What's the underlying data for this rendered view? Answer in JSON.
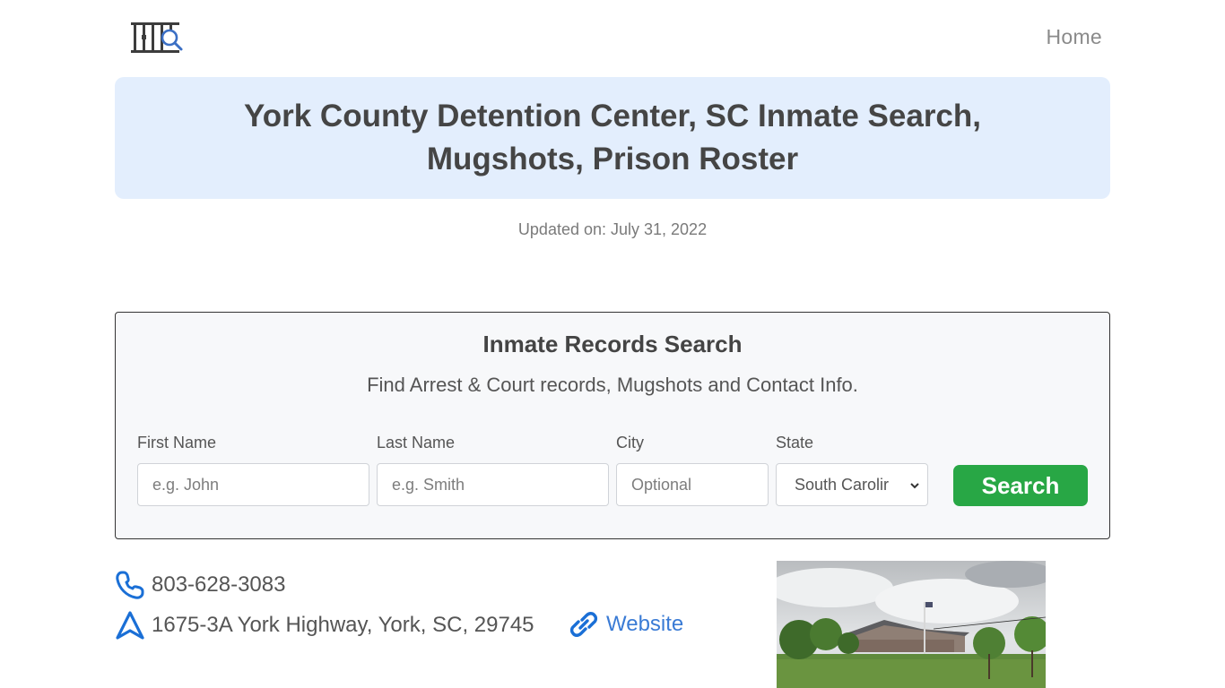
{
  "header": {
    "logo_icon": "jail-bars-magnifier-icon",
    "nav": [
      {
        "label": "Home"
      }
    ]
  },
  "title": "York County Detention Center, SC Inmate Search, Mugshots, Prison Roster",
  "updated": "Updated on: July 31, 2022",
  "search": {
    "title": "Inmate Records Search",
    "subtitle": "Find Arrest & Court records, Mugshots and Contact Info.",
    "fields": {
      "first_name": {
        "label": "First Name",
        "placeholder": "e.g. John",
        "value": ""
      },
      "last_name": {
        "label": "Last Name",
        "placeholder": "e.g. Smith",
        "value": ""
      },
      "city": {
        "label": "City",
        "placeholder": "Optional",
        "value": ""
      },
      "state": {
        "label": "State",
        "selected": "South Carolina",
        "visible_text": "South Carolir"
      }
    },
    "button_label": "Search",
    "button_color": "#28a745"
  },
  "contact": {
    "phone": "803-628-3083",
    "phone_icon": "phone-icon",
    "address": "1675-3A York Highway, York, SC, 29745",
    "address_icon": "navigation-arrow-icon",
    "website_label": "Website",
    "website_icon": "link-icon",
    "accent_color": "#1a6fd6"
  },
  "photo": {
    "alt": "York County Detention Center building"
  }
}
